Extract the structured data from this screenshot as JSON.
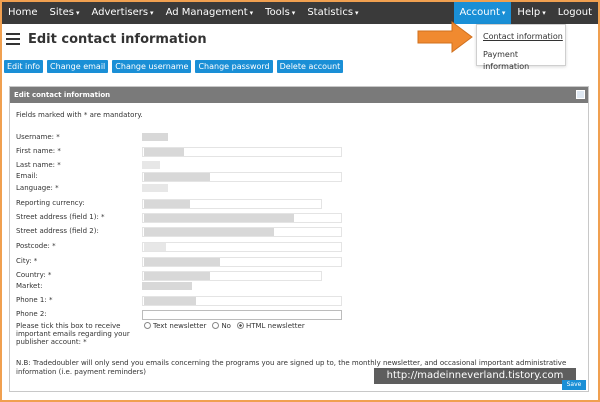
{
  "nav": {
    "items": [
      {
        "label": "Home",
        "caret": false
      },
      {
        "label": "Sites",
        "caret": true
      },
      {
        "label": "Advertisers",
        "caret": true
      },
      {
        "label": "Ad Management",
        "caret": true
      },
      {
        "label": "Tools",
        "caret": true
      },
      {
        "label": "Statistics",
        "caret": true
      }
    ],
    "account": "Account",
    "help": "Help",
    "logout": "Logout",
    "caret": "▾"
  },
  "account_menu": {
    "items": [
      "Contact information",
      "Payment information"
    ]
  },
  "page": {
    "title": "Edit contact information"
  },
  "actions": [
    "Edit info",
    "Change email",
    "Change username",
    "Change password",
    "Delete account"
  ],
  "panel": {
    "title": "Edit contact information",
    "mandatory_note": "Fields marked with * are mandatory."
  },
  "form": {
    "labels": {
      "username": "Username: *",
      "first_name": "First name: *",
      "last_name": "Last name: *",
      "email": "Email:",
      "language": "Language: *",
      "currency": "Reporting currency:",
      "street1": "Street address (field 1): *",
      "street2": "Street address (field 2):",
      "postcode": "Postcode: *",
      "city": "City: *",
      "country": "Country: *",
      "market": "Market:",
      "phone1": "Phone 1: *",
      "phone2": "Phone 2:",
      "newsletter": "Please tick this box to receive important emails regarding your publisher account: *"
    },
    "newsletter_options": [
      "Text newsletter",
      "No",
      "HTML newsletter"
    ]
  },
  "footer_note": "N.B: Tradedoubler will only send you emails concerning the programs you are signed up to, the monthly newsletter, and occasional important administrative information (i.e. payment reminders)",
  "save_label": "Save",
  "watermark": "http://madeinneverland.tistory.com",
  "colors": {
    "accent": "#1a8fd6",
    "nav_bg": "#3a3a3a",
    "panel_head": "#7a7a7a",
    "arrow": "#f08a30"
  }
}
